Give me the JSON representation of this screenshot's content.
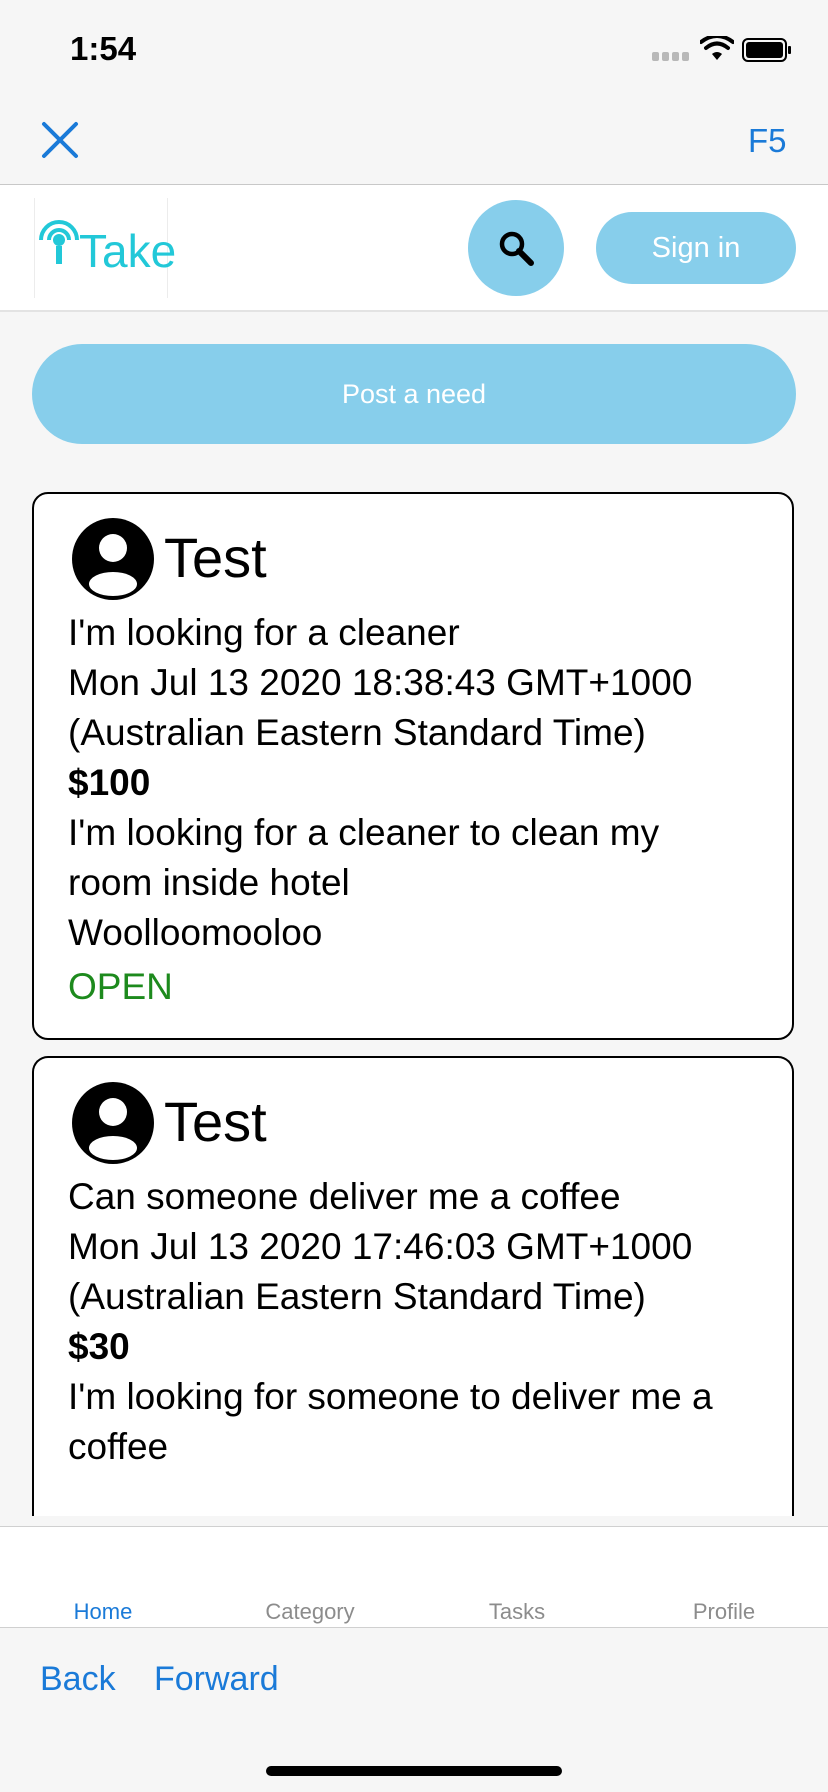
{
  "status_bar": {
    "time": "1:54"
  },
  "browser": {
    "refresh_label": "F5",
    "back_label": "Back",
    "forward_label": "Forward"
  },
  "header": {
    "logo_text": "Take",
    "signin_label": "Sign in"
  },
  "post_need_label": "Post a need",
  "posts": [
    {
      "user": "Test",
      "title": "I'm looking for a cleaner",
      "date_line1": "Mon Jul 13 2020 18:38:43 GMT+1000",
      "date_line2": "(Australian Eastern Standard Time)",
      "price": "$100",
      "desc_line1": "I'm looking for a cleaner to clean my",
      "desc_line2": "room inside hotel",
      "location": "Woolloomooloo",
      "status": "OPEN"
    },
    {
      "user": "Test",
      "title": "Can someone deliver me a coffee",
      "date_line1": "Mon Jul 13 2020 17:46:03 GMT+1000",
      "date_line2": "(Australian Eastern Standard Time)",
      "price": "$30",
      "desc_line1": "I'm looking for someone to deliver me a",
      "desc_line2": "coffee"
    }
  ],
  "tabs": [
    {
      "label": "Home",
      "active": true
    },
    {
      "label": "Category",
      "active": false
    },
    {
      "label": "Tasks",
      "active": false
    },
    {
      "label": "Profile",
      "active": false
    }
  ],
  "colors": {
    "accent": "#87ceeb",
    "link": "#1a7ad8",
    "open_status": "#1d8a1d",
    "logo": "#22c8d8"
  }
}
